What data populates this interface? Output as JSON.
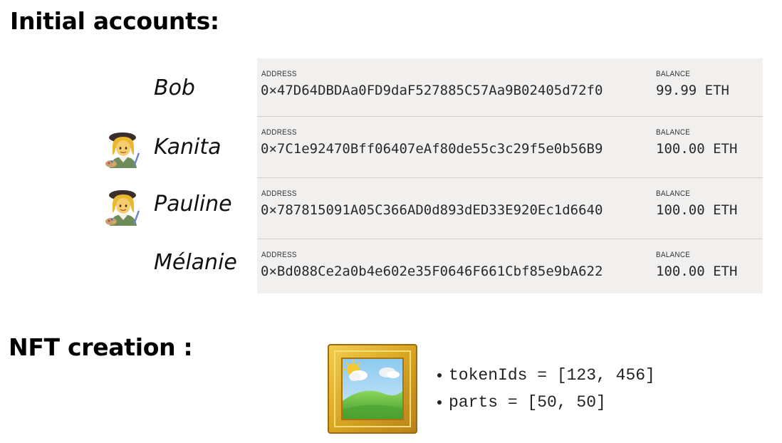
{
  "headings": {
    "initial_accounts": "Initial accounts:",
    "nft_creation": "NFT creation :"
  },
  "accounts": [
    {
      "name": "Bob",
      "address_label": "ADDRESS",
      "address": "0×47D64DBDAa0FD9daF527885C57Aa9B02405d72f0",
      "balance_label": "BALANCE",
      "balance": "99.99 ETH",
      "icon": null
    },
    {
      "name": "Kanita",
      "address_label": "ADDRESS",
      "address": "0×7C1e92470Bff06407eAf80de55c3c29f5e0b56B9",
      "balance_label": "BALANCE",
      "balance": "100.00 ETH",
      "icon": "woman-artist-icon"
    },
    {
      "name": "Pauline",
      "address_label": "ADDRESS",
      "address": "0×787815091A05C366AD0d893dED33E920Ec1d6640",
      "balance_label": "BALANCE",
      "balance": "100.00 ETH",
      "icon": "woman-artist-icon"
    },
    {
      "name": "Mélanie",
      "address_label": "ADDRESS",
      "address": "0×Bd088Ce2a0b4e602e35F0646F661Cbf85e9bA622",
      "balance_label": "BALANCE",
      "balance": "100.00 ETH",
      "icon": null
    }
  ],
  "nft": {
    "icon": "framed-picture-icon",
    "bullets": [
      "tokenIds = [123, 456]",
      "parts = [50, 50]"
    ]
  },
  "colors": {
    "panel_bg": "#f2f0ee",
    "divider": "#d5d1cc",
    "frame_gold": "#d9a520"
  }
}
